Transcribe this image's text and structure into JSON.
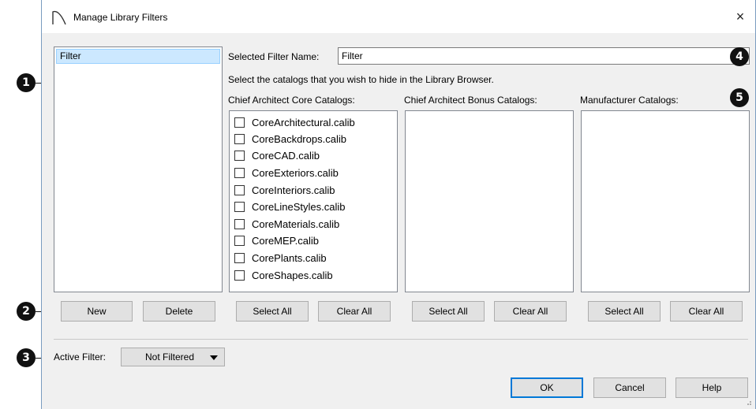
{
  "dialog": {
    "title": "Manage Library Filters",
    "close_glyph": "×",
    "icon": "chief-architect-logo-icon"
  },
  "filters_list": {
    "items": [
      "Filter"
    ]
  },
  "filter_buttons": {
    "new": "New",
    "delete": "Delete"
  },
  "selected_filter": {
    "label": "Selected Filter Name:",
    "value": "Filter"
  },
  "instructions": "Select the catalogs that you wish to hide in the Library Browser.",
  "catalog_columns": [
    {
      "header": "Chief Architect Core Catalogs:",
      "items": [
        "CoreArchitectural.calib",
        "CoreBackdrops.calib",
        "CoreCAD.calib",
        "CoreExteriors.calib",
        "CoreInteriors.calib",
        "CoreLineStyles.calib",
        "CoreMaterials.calib",
        "CoreMEP.calib",
        "CorePlants.calib",
        "CoreShapes.calib"
      ],
      "select_all": "Select All",
      "clear_all": "Clear All"
    },
    {
      "header": "Chief Architect Bonus Catalogs:",
      "items": [],
      "select_all": "Select All",
      "clear_all": "Clear All"
    },
    {
      "header": "Manufacturer Catalogs:",
      "items": [],
      "select_all": "Select All",
      "clear_all": "Clear All"
    }
  ],
  "active_filter": {
    "label": "Active Filter:",
    "value": "Not Filtered"
  },
  "footer": {
    "ok": "OK",
    "cancel": "Cancel",
    "help": "Help"
  },
  "callouts": [
    "1",
    "2",
    "3",
    "4",
    "5"
  ],
  "colors": {
    "selection_bg": "#cce8ff",
    "default_button_border": "#0078d7",
    "dialog_bg": "#f0f0f0"
  }
}
